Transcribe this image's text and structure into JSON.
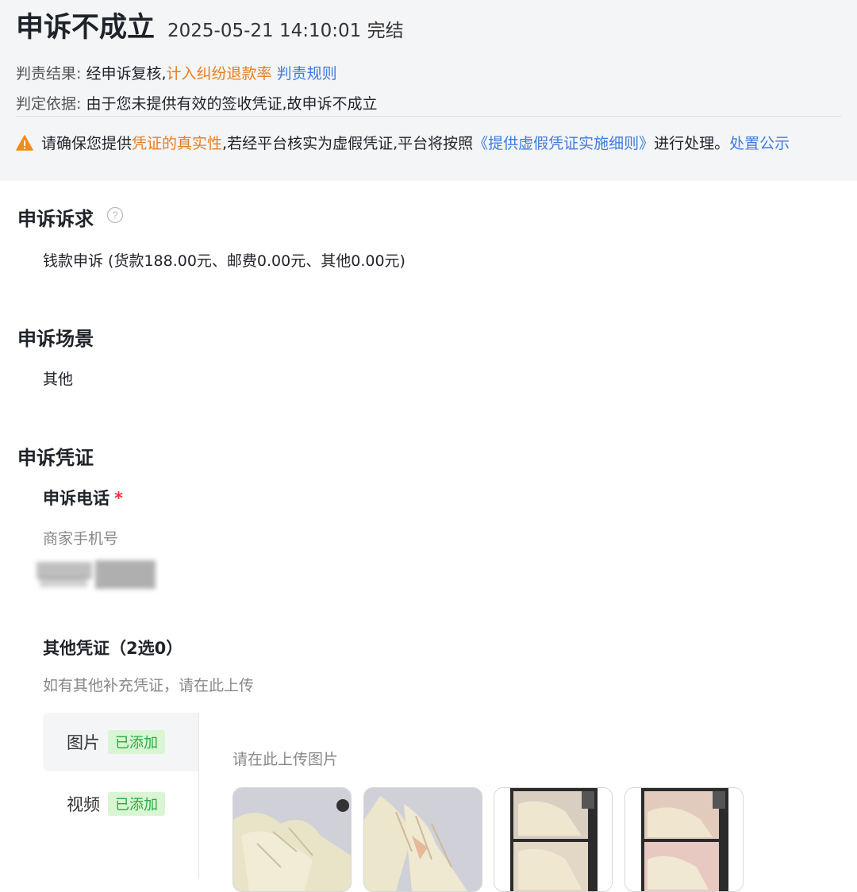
{
  "header": {
    "title": "申诉不成立",
    "meta": "2025-05-21 14:10:01 完结",
    "result": {
      "label": "判责结果:",
      "text": "经申诉复核,",
      "highlight": "计入纠纷退款率",
      "link": "判责规则"
    },
    "basis": {
      "label": "判定依据:",
      "text": "由于您未提供有效的签收凭证,故申诉不成立"
    },
    "warning": {
      "icon": "warning-icon",
      "p1": "请确保您提供",
      "highlight": "凭证的真实性",
      "p2": ",若经平台核实为虚假凭证,平台将按照",
      "link": "《提供虚假凭证实施细则》",
      "p3": "进行处理。",
      "link2": "处置公示"
    }
  },
  "appeal_request": {
    "title": "申诉诉求",
    "help_icon": "question-circle-icon",
    "text": "钱款申诉 (货款188.00元、邮费0.00元、其他0.00元)"
  },
  "appeal_scene": {
    "title": "申诉场景",
    "text": "其他"
  },
  "appeal_evidence": {
    "title": "申诉凭证",
    "phone": {
      "title": "申诉电话",
      "required_mark": "*",
      "hint": "商家手机号"
    },
    "other": {
      "title": "其他凭证（2选0）",
      "hint": "如有其他补充凭证，请在此上传",
      "tabs": [
        {
          "label": "图片",
          "badge": "已添加"
        },
        {
          "label": "视频",
          "badge": "已添加"
        }
      ],
      "upload_hint": "请在此上传图片"
    }
  },
  "colors": {
    "orange": "#e87d1e",
    "blue": "#3d7be0",
    "badge_bg": "#d9f5d3",
    "badge_text": "#2ca845",
    "required": "#e03a3a"
  }
}
